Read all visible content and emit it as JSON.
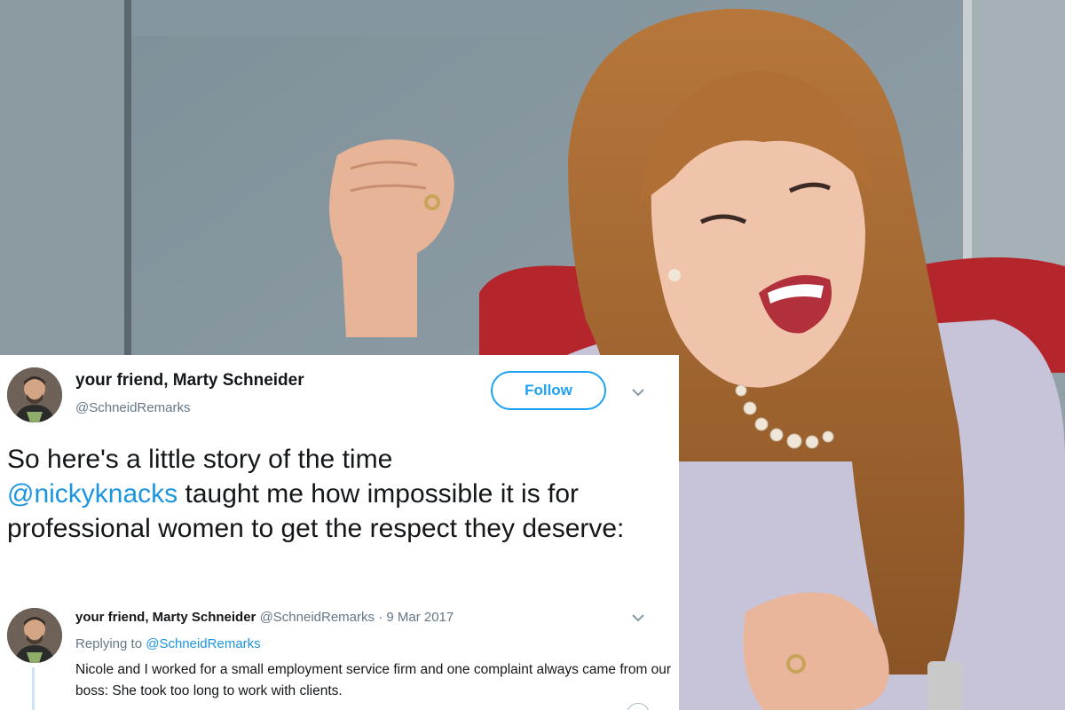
{
  "tweet": {
    "author_name": "your friend, Marty Schneider",
    "author_handle": "@SchneidRemarks",
    "follow_label": "Follow",
    "text_part1": "So here's a little story of the time",
    "mention": "@nickyknacks",
    "text_part2": " taught me how impossible it is for professional women to get the respect they deserve:"
  },
  "reply": {
    "author_name": "your friend, Marty Schneider",
    "author_handle": "@SchneidRemarks",
    "date": "9 Mar 2017",
    "replying_prefix": "Replying to",
    "replying_handle": "@SchneidRemarks",
    "text": "Nicole and I worked for a small employment service firm and one complaint always came from our boss: She took too long to work with clients."
  },
  "colors": {
    "link": "#1b95e0",
    "follow_border": "#1da1f2",
    "secondary_text": "#657786"
  },
  "icons": {
    "caret": "chevron-down-icon",
    "avatar": "avatar"
  }
}
